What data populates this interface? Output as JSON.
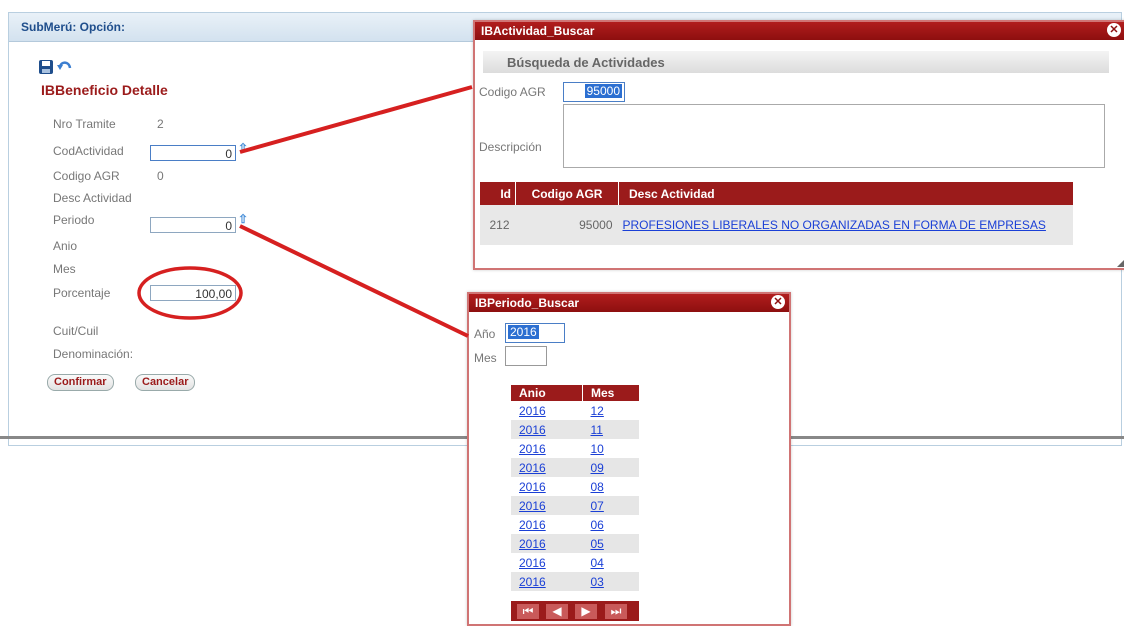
{
  "main": {
    "submenu_title": "SubMerú: Opción:",
    "section_title": "IBBeneficio Detalle",
    "fields": {
      "nro_tramite_label": "Nro Tramite",
      "nro_tramite_value": "2",
      "codactividad_label": "CodActividad",
      "codactividad_value": "0",
      "codigo_agr_label": "Codigo AGR",
      "codigo_agr_value": "0",
      "desc_actividad_label": "Desc Actividad",
      "periodo_label": "Periodo",
      "periodo_value": "0",
      "anio_label": "Anio",
      "mes_label": "Mes",
      "porcentaje_label": "Porcentaje",
      "porcentaje_value": "100,00",
      "cuit_label": "Cuit/Cuil",
      "denominacion_label": "Denominación:"
    },
    "buttons": {
      "confirmar": "Confirmar",
      "cancelar": "Cancelar"
    }
  },
  "actividad_dialog": {
    "title": "IBActividad_Buscar",
    "subtitle": "Búsqueda de Actividades",
    "codigo_agr_label": "Codigo AGR",
    "codigo_agr_value": "95000",
    "descripcion_label": "Descripción",
    "descripcion_value": "",
    "columns": [
      "Id",
      "Codigo AGR",
      "Desc Actividad"
    ],
    "rows": [
      {
        "id": "212",
        "codigo": "95000",
        "desc": "PROFESIONES LIBERALES NO ORGANIZADAS EN FORMA DE EMPRESAS"
      }
    ]
  },
  "periodo_dialog": {
    "title": "IBPeriodo_Buscar",
    "anio_label": "Año",
    "anio_value": "2016",
    "mes_label": "Mes",
    "mes_value": "",
    "columns": [
      "Anio",
      "Mes"
    ],
    "rows": [
      {
        "anio": "2016",
        "mes": "12"
      },
      {
        "anio": "2016",
        "mes": "11"
      },
      {
        "anio": "2016",
        "mes": "10"
      },
      {
        "anio": "2016",
        "mes": "09"
      },
      {
        "anio": "2016",
        "mes": "08"
      },
      {
        "anio": "2016",
        "mes": "07"
      },
      {
        "anio": "2016",
        "mes": "06"
      },
      {
        "anio": "2016",
        "mes": "05"
      },
      {
        "anio": "2016",
        "mes": "04"
      },
      {
        "anio": "2016",
        "mes": "03"
      }
    ]
  },
  "icons": {
    "save": "save-icon",
    "undo": "undo-icon",
    "lookup": "lookup-arrow-icon",
    "close": "close-icon",
    "pager": [
      "first-page-icon",
      "prev-page-icon",
      "next-page-icon",
      "last-page-icon"
    ]
  },
  "colors": {
    "dialog_title": "#9b1b1b",
    "annotation": "#d62020",
    "link": "#1a3fd6",
    "submenu_text": "#1f4e8c"
  }
}
